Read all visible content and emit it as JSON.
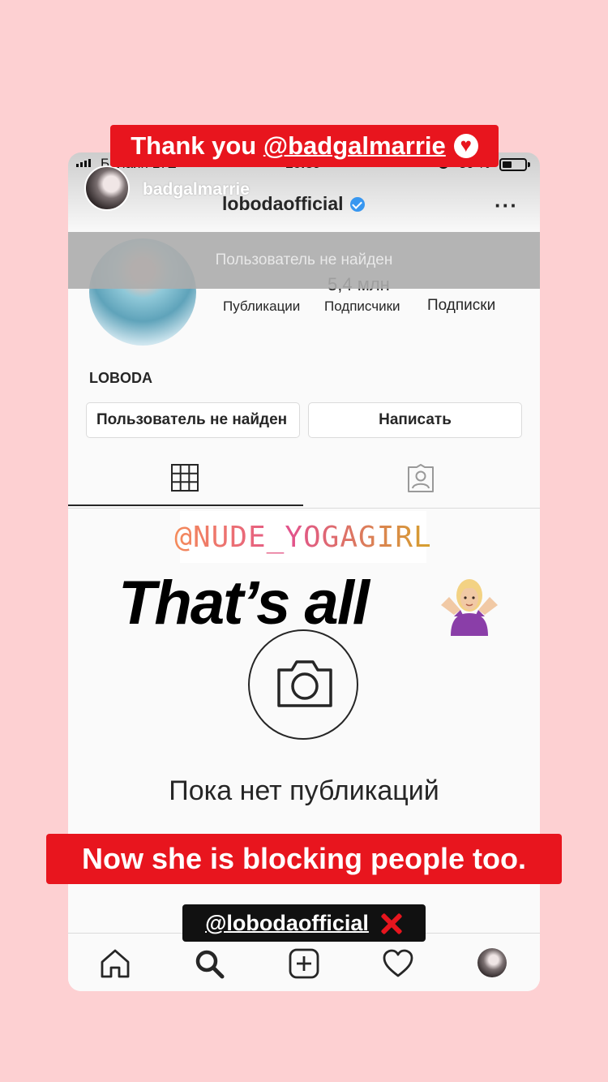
{
  "story": {
    "username": "badgalmarrie",
    "caption_top": {
      "prefix": "Thank you ",
      "mention": "@badgalmarrie"
    },
    "gif_sticker": "@NUDE_YOGAGIRL",
    "headline": "That’s all",
    "caption_bottom": "Now she is blocking people too.",
    "mention_sticker": "@lobodaofficial"
  },
  "statusbar": {
    "carrier": "Билайн  LTE",
    "time": "16:39",
    "battery_pct": "39 %"
  },
  "profile": {
    "handle": "lobodaofficial",
    "notfound_banner": "Пользователь не найден",
    "followers_partial": "5,4 млн",
    "stat_labels": [
      "Публикации",
      "Подписчики",
      "Подписки"
    ],
    "name": "LOBODA",
    "button_left": "Пользователь не найден",
    "button_right": "Написать",
    "empty_text": "Пока нет публикаций"
  },
  "icons": {
    "grid": "grid-icon",
    "tagged": "tagged-icon",
    "camera": "camera-icon",
    "home": "home-icon",
    "search": "search-icon",
    "add": "add-post-icon",
    "heart": "heart-icon"
  },
  "colors": {
    "background": "#fdd0d2",
    "sticker_red": "#e8151e",
    "verified_blue": "#3897f0"
  }
}
